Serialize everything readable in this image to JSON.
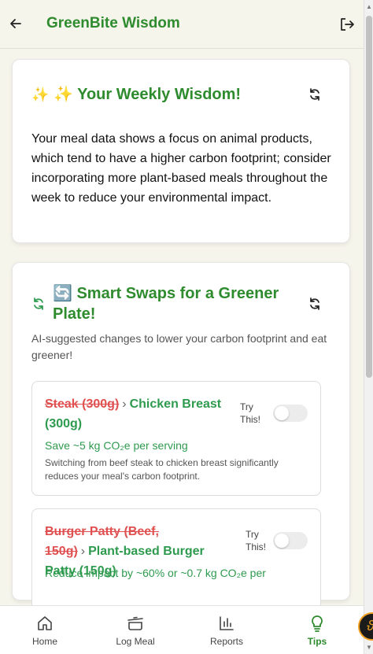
{
  "header": {
    "title": "GreenBite Wisdom"
  },
  "weekly": {
    "emoji": "✨",
    "title": "✨ Your Weekly Wisdom!",
    "text": "Your meal data shows a focus on animal products, which tend to have a higher carbon footprint; consider incorporating more plant-based meals throughout the week to reduce your environmental impact."
  },
  "swaps": {
    "title": "🔄 Smart Swaps for a Greener Plate!",
    "subtitle": "AI-suggested changes to lower your carbon footprint and eat greener!",
    "items": [
      {
        "from": "Steak (300g)",
        "to": "Chicken Breast (300g)",
        "try_label": "Try This!",
        "enabled": false,
        "savings": "Save ~5 kg CO₂e per serving",
        "explanation": "Switching from beef steak to chicken breast significantly reduces your meal's carbon footprint."
      },
      {
        "from": "Burger Patty (Beef, 150g)",
        "to": "Plant-based Burger Patty (150g)",
        "try_label": "Try This!",
        "enabled": false,
        "savings": "Reduce impact by ~60% or ~0.7 kg CO₂e per"
      }
    ]
  },
  "nav": {
    "items": [
      {
        "label": "Home",
        "icon": "home-icon"
      },
      {
        "label": "Log Meal",
        "icon": "pot-icon"
      },
      {
        "label": "Reports",
        "icon": "bar-chart-icon"
      },
      {
        "label": "Tips",
        "icon": "lightbulb-icon",
        "active": true
      }
    ]
  },
  "colors": {
    "brand_green": "#2e8b2e",
    "strike_red": "#e05050",
    "background": "#f6f5ec"
  }
}
